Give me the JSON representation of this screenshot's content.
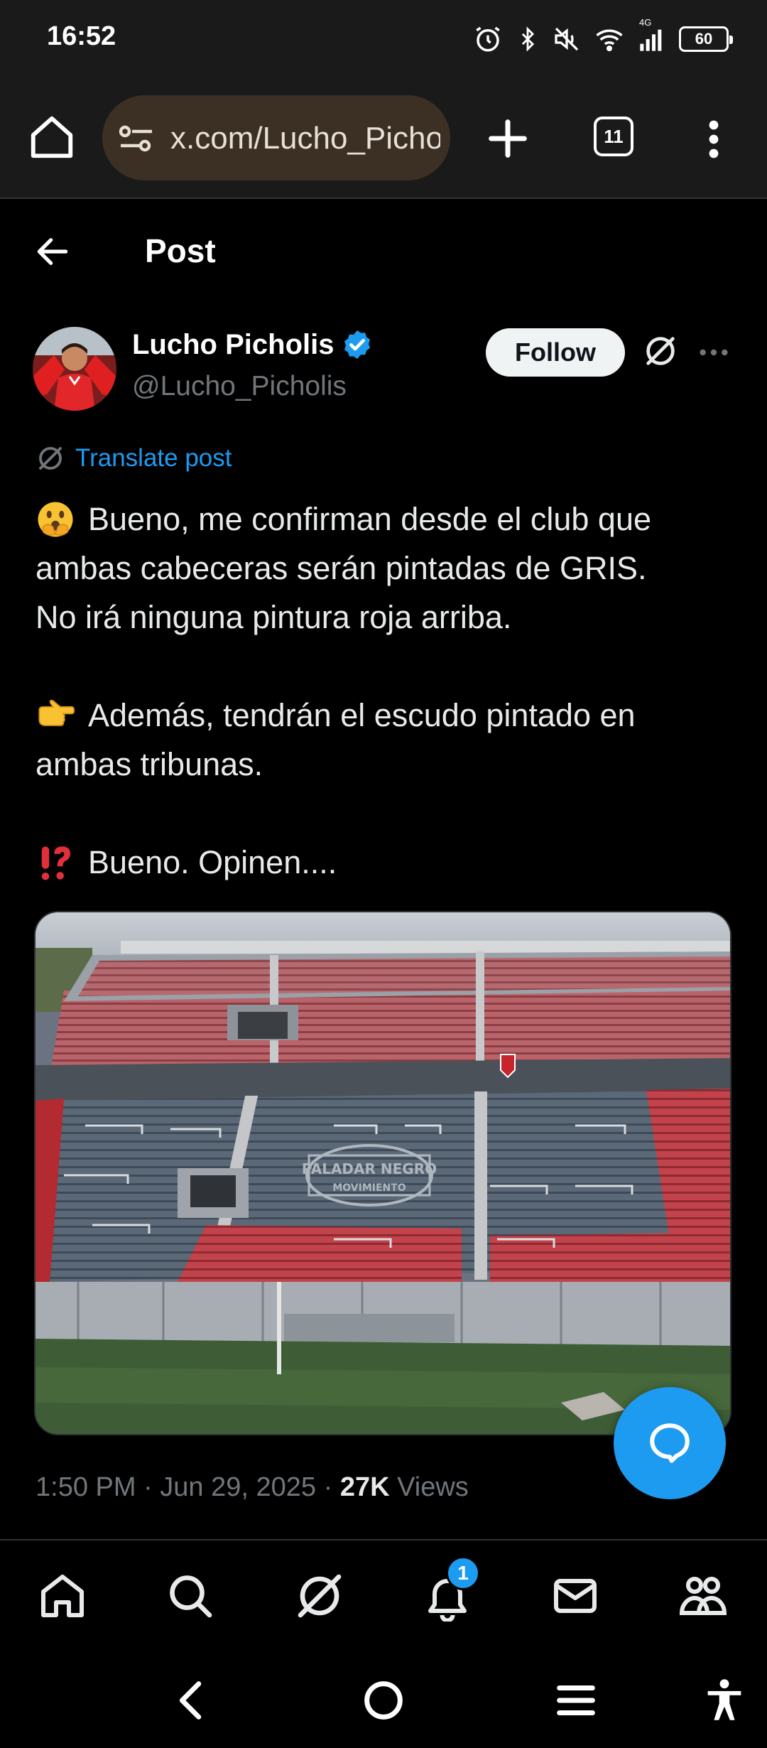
{
  "status_bar": {
    "time": "16:52",
    "network": "4G",
    "battery": "60",
    "icons": [
      "alarm-icon",
      "bluetooth-icon",
      "mute-icon",
      "wifi-icon",
      "signal-icon",
      "battery-icon"
    ]
  },
  "browser": {
    "url": "x.com/Lucho_Picholis",
    "tab_count": "11",
    "icons": [
      "home-icon",
      "site-settings-icon",
      "new-tab-icon",
      "tabs-icon",
      "menu-icon"
    ]
  },
  "header": {
    "title": "Post"
  },
  "author": {
    "name": "Lucho Picholis",
    "handle": "@Lucho_Picholis",
    "verified": true,
    "follow_label": "Follow"
  },
  "post": {
    "translate_label": "Translate post",
    "line_1a": "Bueno, me confirman desde el club que",
    "line_1b": "ambas cabeceras serán pintadas de GRIS.",
    "line_1c": "No irá ninguna pintura roja arriba.",
    "line_2a": "Además, tendrán el escudo pintado en",
    "line_2b": "ambas tribunas.",
    "line_3a": "Bueno. Opinen....",
    "emojis": [
      "face-with-open-eyes-and-hand-over-mouth",
      "backhand-index-pointing-right",
      "exclamation-question-mark"
    ],
    "media_banner": "PALADAR NEGRO",
    "media_banner_sub": "MOVIMIENTO",
    "timestamp": "1:50 PM · Jun 29, 2025 · ",
    "views_count": "27K",
    "views_label": " Views"
  },
  "nav": {
    "items": [
      "home",
      "search",
      "grok",
      "notifications",
      "messages",
      "communities"
    ],
    "notification_badge": "1"
  },
  "colors": {
    "accent": "#1d9bf0",
    "background": "#000000",
    "text": "#e7e9ea",
    "muted": "#71767b",
    "url_pill": "#3b3023"
  }
}
